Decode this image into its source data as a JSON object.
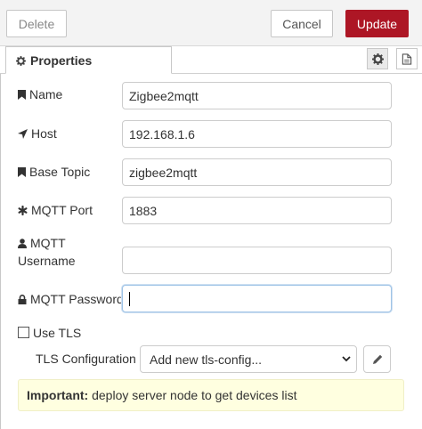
{
  "toolbar": {
    "delete_label": "Delete",
    "cancel_label": "Cancel",
    "update_label": "Update",
    "update_color": "#ad1625"
  },
  "tabs": {
    "properties_label": "Properties",
    "properties_icon": "cog-icon",
    "node_settings_icon": "gear-icon",
    "description_icon": "document-icon"
  },
  "form": {
    "name": {
      "label": "Name",
      "icon": "bookmark-icon",
      "value": "Zigbee2mqtt"
    },
    "host": {
      "label": "Host",
      "icon": "location-arrow-icon",
      "value": "192.168.1.6"
    },
    "base_topic": {
      "label": "Base Topic",
      "icon": "bookmark-icon",
      "value": "zigbee2mqtt"
    },
    "mqtt_port": {
      "label": "MQTT Port",
      "icon": "asterisk-icon",
      "value": "1883"
    },
    "mqtt_username": {
      "label_line1": "MQTT",
      "label_line2": "Username",
      "icon": "user-icon",
      "value": ""
    },
    "mqtt_password": {
      "label": "MQTT Password",
      "icon": "lock-icon",
      "value": ""
    },
    "use_tls": {
      "label": "Use TLS",
      "checked": false
    },
    "tls_configuration": {
      "label": "TLS Configuration",
      "selected": "Add new tls-config...",
      "edit_icon": "pencil-icon"
    }
  },
  "notice": {
    "bold": "Important:",
    "text": " deploy server node to get devices list",
    "background": "#ffffe0"
  }
}
